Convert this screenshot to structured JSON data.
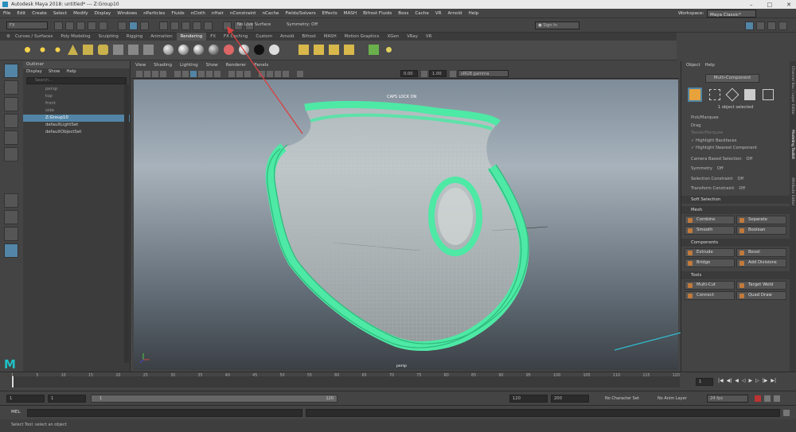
{
  "window": {
    "title": "Autodesk Maya 2018: untitled*  ---  Z:Group10",
    "controls": [
      "–",
      "□",
      "✕"
    ]
  },
  "menubar": {
    "items": [
      "File",
      "Edit",
      "Create",
      "Select",
      "Modify",
      "Display",
      "Windows",
      "nParticles",
      "Fluids",
      "nCloth",
      "nHair",
      "nConstraint",
      "nCache",
      "Fields/Solvers",
      "Effects",
      "MASH",
      "Bifrost Fluids",
      "Boss",
      "Cache",
      "VR",
      "Arnold",
      "Help"
    ],
    "workspace_label": "Workspace:",
    "workspace_value": "Maya Classic*"
  },
  "statusline": {
    "mode": "FX",
    "live_surface": "No Live Surface",
    "symmetry": "Symmetry: Off",
    "sign_in": "Sign In"
  },
  "shelf": {
    "tabs": [
      "Curves / Surfaces",
      "Poly Modeling",
      "Sculpting",
      "Rigging",
      "Animation",
      "Rendering",
      "FX",
      "FX Caching",
      "Custom",
      "Arnold",
      "Bifrost",
      "MASH",
      "Motion Graphics",
      "XGen",
      "VRay",
      "VR"
    ],
    "active_tab": "Rendering"
  },
  "outliner": {
    "title": "Outliner",
    "menus": [
      "Display",
      "Show",
      "Help"
    ],
    "search_placeholder": "Search...",
    "items": [
      "persp",
      "top",
      "front",
      "side",
      "Z:Group10",
      "defaultLightSet",
      "defaultObjectSet"
    ],
    "selected": "Z:Group10"
  },
  "viewport": {
    "menus": [
      "View",
      "Shading",
      "Lighting",
      "Show",
      "Renderer",
      "Panels"
    ],
    "field_a": "0.00",
    "field_b": "1.00",
    "color_space": "sRGB gamma",
    "caps_lock": "CAPS LOCK ON",
    "camera": "persp"
  },
  "modeling_toolkit": {
    "menus": [
      "Object",
      "Help"
    ],
    "component_button": "Multi-Component",
    "selected_count": "1 object selected",
    "pick_marquee": "Pick/Marquee",
    "drag": "Drag",
    "tweak_marquee": "Tweak/Marquee",
    "highlight_backfaces": "Highlight Backfaces",
    "highlight_nearest": "Highlight Nearest Component",
    "camera_based": "Camera Based Selection",
    "camera_based_value": "Off",
    "symmetry": "Symmetry",
    "symmetry_value": "Off",
    "selection_constraint": "Selection Constraint",
    "selection_constraint_value": "Off",
    "transform_constraint": "Transform Constraint",
    "transform_constraint_value": "Off",
    "soft_selection": "Soft Selection",
    "sections": {
      "mesh": "Mesh",
      "components": "Components",
      "tools": "Tools"
    },
    "mesh_buttons": [
      "Combine",
      "Separate",
      "Smooth",
      "Boolean"
    ],
    "component_buttons": [
      "Extrude",
      "Bevel",
      "Bridge",
      "Add Divisions"
    ],
    "tool_buttons": [
      "Multi-Cut",
      "Target Weld",
      "Connect",
      "Quad Draw"
    ],
    "side_tabs": [
      "Channel Box / Layer Editor",
      "Modeling Toolkit",
      "Attribute Editor"
    ]
  },
  "timeline": {
    "ticks": [
      "1",
      "5",
      "10",
      "15",
      "20",
      "25",
      "30",
      "35",
      "40",
      "45",
      "50",
      "55",
      "60",
      "65",
      "70",
      "75",
      "80",
      "85",
      "90",
      "95",
      "100",
      "105",
      "110",
      "115",
      "120"
    ],
    "current_frame": "1"
  },
  "range": {
    "start": "1",
    "start2": "1",
    "slider_start": "1",
    "slider_end": "120",
    "end": "120",
    "end2": "200",
    "character_set": "No Character Set",
    "anim_layer": "No Anim Layer",
    "fps": "24 fps"
  },
  "cmdline": {
    "label": "MEL"
  },
  "help": {
    "text": "Select Tool: select an object"
  },
  "colors": {
    "mesh": "#4de9a5",
    "selection": "#5285a6",
    "annotation_red": "#d94040",
    "annotation_cyan": "#31b8c9"
  }
}
